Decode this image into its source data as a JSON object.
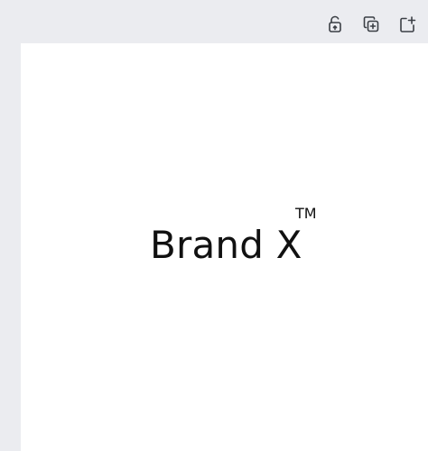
{
  "toolbar": {
    "icons": [
      {
        "name": "unlock-icon"
      },
      {
        "name": "duplicate-icon"
      },
      {
        "name": "add-page-icon"
      }
    ]
  },
  "canvas": {
    "brand_text": "Brand X",
    "trademark": "TM"
  },
  "colors": {
    "background": "#ebecf0",
    "canvas": "#ffffff",
    "text": "#111111",
    "icon": "#3b3f45"
  }
}
